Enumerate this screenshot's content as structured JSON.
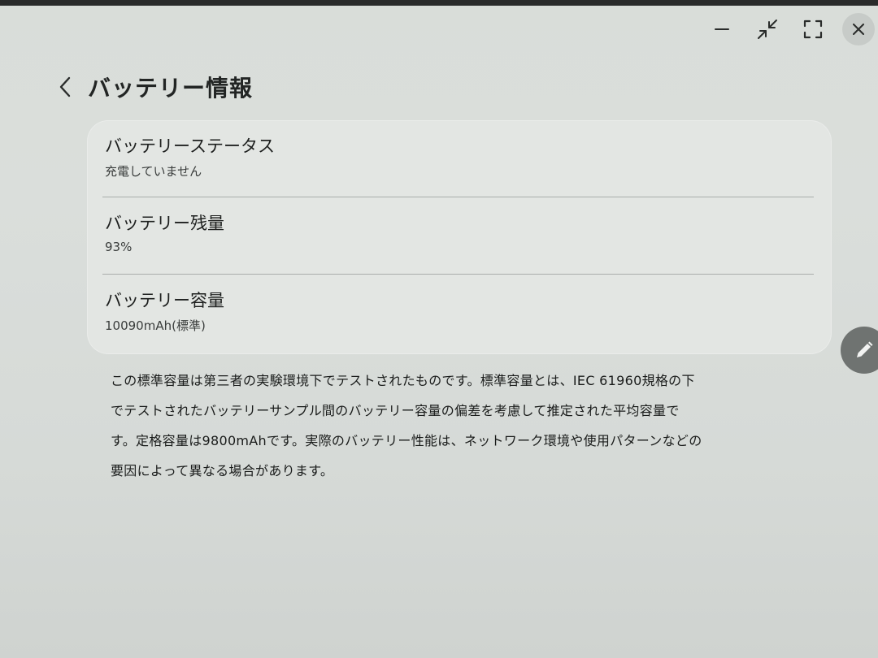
{
  "window": {
    "controls": [
      "minimize-icon",
      "collapse-icon",
      "fullscreen-icon",
      "close-icon"
    ]
  },
  "header": {
    "title": "バッテリー情報"
  },
  "items": [
    {
      "title": "バッテリーステータス",
      "value": "充電していません"
    },
    {
      "title": "バッテリー残量",
      "value": "93%"
    },
    {
      "title": "バッテリー容量",
      "value": "10090mAh(標準)"
    }
  ],
  "note": {
    "line1": "この標準容量は第三者の実験環境下でテストされたものです。標準容量とは、IEC 61960規格の下",
    "line2": "でテストされたバッテリーサンプル間のバッテリー容量の偏差を考慮して推定された平均容量で",
    "line3": "す。定格容量は9800mAhです。実際のバッテリー性能は、ネットワーク環境や使用パターンなどの",
    "line4": "要因によって異なる場合があります。"
  },
  "fab": {
    "icon": "pencil-icon"
  },
  "colors": {
    "background": "#d9ddd9",
    "card": "#e3e6e3",
    "text": "#1b1d1c",
    "fab": "#6f7371"
  }
}
